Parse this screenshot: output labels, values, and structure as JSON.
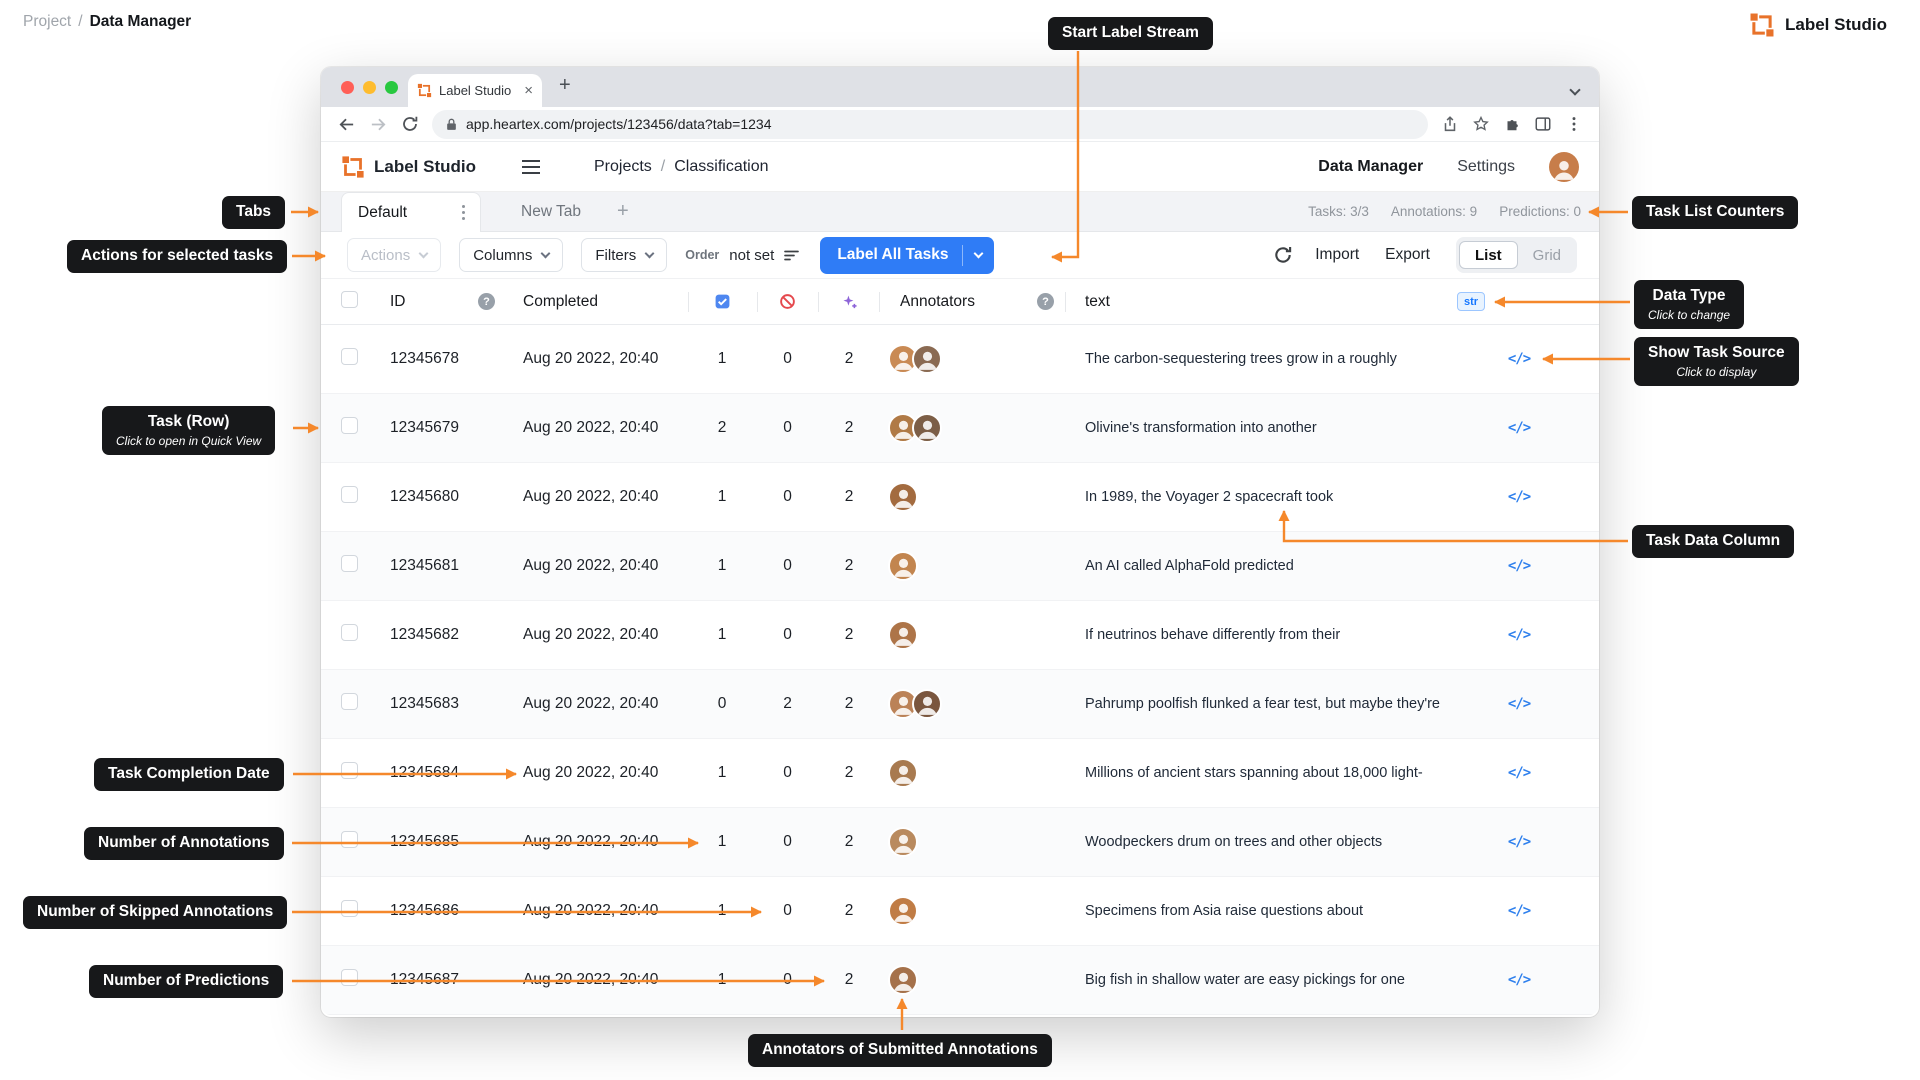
{
  "colors": {
    "accent_orange": "#f5882b",
    "brand_orange": "#e8722a",
    "primary_blue": "#2f7cf6",
    "badge_blue": "#1677ff"
  },
  "page_breadcrumb": {
    "root": "Project",
    "sep": "/",
    "current": "Data Manager"
  },
  "brand": {
    "name": "Label Studio"
  },
  "browser": {
    "tab_title": "Label Studio",
    "close": "×",
    "url": "app.heartex.com/projects/123456/data?tab=1234"
  },
  "header": {
    "brand": "Label Studio",
    "crumb_root": "Projects",
    "crumb_sep": "/",
    "crumb_current": "Classification",
    "nav_data_manager": "Data Manager",
    "nav_settings": "Settings"
  },
  "tabs": {
    "active": "Default",
    "second": "New Tab",
    "add": "+",
    "counters": {
      "tasks": "Tasks: 3/3",
      "annotations": "Annotations: 9",
      "predictions": "Predictions: 0"
    }
  },
  "toolbar": {
    "actions": "Actions",
    "columns": "Columns",
    "filters": "Filters",
    "order_label": "Order",
    "order_value": "not set",
    "label_all_tasks": "Label All Tasks",
    "import": "Import",
    "export": "Export",
    "list": "List",
    "grid": "Grid"
  },
  "table": {
    "headers": {
      "id": "ID",
      "completed": "Completed",
      "annotators": "Annotators",
      "text": "text",
      "help": "?"
    },
    "data_type_badge": "str",
    "source_icon": "</>",
    "rows": [
      {
        "id": "12345678",
        "completed": "Aug 20 2022, 20:40",
        "annotations": "1",
        "skipped": "0",
        "predictions": "2",
        "annotators": 2,
        "text": "The carbon-sequestering trees grow in a roughly"
      },
      {
        "id": "12345679",
        "completed": "Aug 20 2022, 20:40",
        "annotations": "2",
        "skipped": "0",
        "predictions": "2",
        "annotators": 2,
        "text": "Olivine's transformation into another"
      },
      {
        "id": "12345680",
        "completed": "Aug 20 2022, 20:40",
        "annotations": "1",
        "skipped": "0",
        "predictions": "2",
        "annotators": 1,
        "text": "In 1989, the Voyager 2 spacecraft took"
      },
      {
        "id": "12345681",
        "completed": "Aug 20 2022, 20:40",
        "annotations": "1",
        "skipped": "0",
        "predictions": "2",
        "annotators": 1,
        "text": "An AI called AlphaFold predicted"
      },
      {
        "id": "12345682",
        "completed": "Aug 20 2022, 20:40",
        "annotations": "1",
        "skipped": "0",
        "predictions": "2",
        "annotators": 1,
        "text": "If neutrinos behave differently from their"
      },
      {
        "id": "12345683",
        "completed": "Aug 20 2022, 20:40",
        "annotations": "0",
        "skipped": "2",
        "predictions": "2",
        "annotators": 2,
        "text": "Pahrump poolfish flunked a fear test, but maybe they're"
      },
      {
        "id": "12345684",
        "completed": "Aug 20 2022, 20:40",
        "annotations": "1",
        "skipped": "0",
        "predictions": "2",
        "annotators": 1,
        "text": "Millions of ancient stars spanning about 18,000 light-"
      },
      {
        "id": "12345685",
        "completed": "Aug 20 2022, 20:40",
        "annotations": "1",
        "skipped": "0",
        "predictions": "2",
        "annotators": 1,
        "text": "Woodpeckers drum on trees and other objects"
      },
      {
        "id": "12345686",
        "completed": "Aug 20 2022, 20:40",
        "annotations": "1",
        "skipped": "0",
        "predictions": "2",
        "annotators": 1,
        "text": "Specimens from Asia raise questions about"
      },
      {
        "id": "12345687",
        "completed": "Aug 20 2022, 20:40",
        "annotations": "1",
        "skipped": "0",
        "predictions": "2",
        "annotators": 1,
        "text": "Big fish in shallow water are easy pickings for one"
      }
    ]
  },
  "callouts": {
    "start_label_stream": {
      "label": "Start Label Stream"
    },
    "tabs": {
      "label": "Tabs"
    },
    "actions": {
      "label": "Actions for selected tasks"
    },
    "task_list_counters": {
      "label": "Task List Counters"
    },
    "data_type": {
      "label": "Data Type",
      "sub": "Click to change"
    },
    "show_task_source": {
      "label": "Show Task Source",
      "sub": "Click to display"
    },
    "task_row": {
      "label": "Task (Row)",
      "sub": "Click to open in Quick View"
    },
    "task_data_column": {
      "label": "Task Data Column"
    },
    "task_completion_date": {
      "label": "Task Completion Date"
    },
    "number_of_annotations": {
      "label": "Number of Annotations"
    },
    "number_of_skipped": {
      "label": "Number of Skipped Annotations"
    },
    "number_of_predictions": {
      "label": "Number of Predictions"
    },
    "annotators_submitted": {
      "label": "Annotators of Submitted Annotations"
    }
  }
}
